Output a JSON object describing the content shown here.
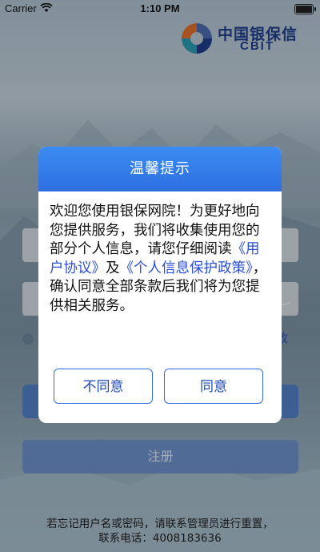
{
  "status_bar": {
    "carrier": "Carrier",
    "time": "1:10 PM",
    "wifi_icon": "wifi-icon",
    "battery_icon": "battery-icon"
  },
  "brand": {
    "name_cn": "中国银保信",
    "name_en": "CBIT",
    "colors": {
      "primary": "#1f3f8e",
      "orange": "#e8742c",
      "teal": "#2a9fb8"
    }
  },
  "background": {
    "forgot_link_partial": "政",
    "eye_icon": "eye-closed-icon"
  },
  "buttons": {
    "register_label": "注册"
  },
  "footer": {
    "line1": "若忘记用户名或密码，请联系管理员进行重置，",
    "line2": "联系电话：4008183636"
  },
  "dialog": {
    "title": "温馨提示",
    "body_intro": "欢迎您使用银保网院！为更好地向您提供服务，我们将收集使用您的部分个人信息，请您仔细阅读",
    "link_user_agreement": "《用户协议》",
    "body_and": "及",
    "link_privacy_policy": "《个人信息保护政策》",
    "body_outro": "，确认同意全部条款后我们将为您提供相关服务。",
    "disagree_label": "不同意",
    "agree_label": "同意",
    "accent_color": "#2f6fe0"
  }
}
